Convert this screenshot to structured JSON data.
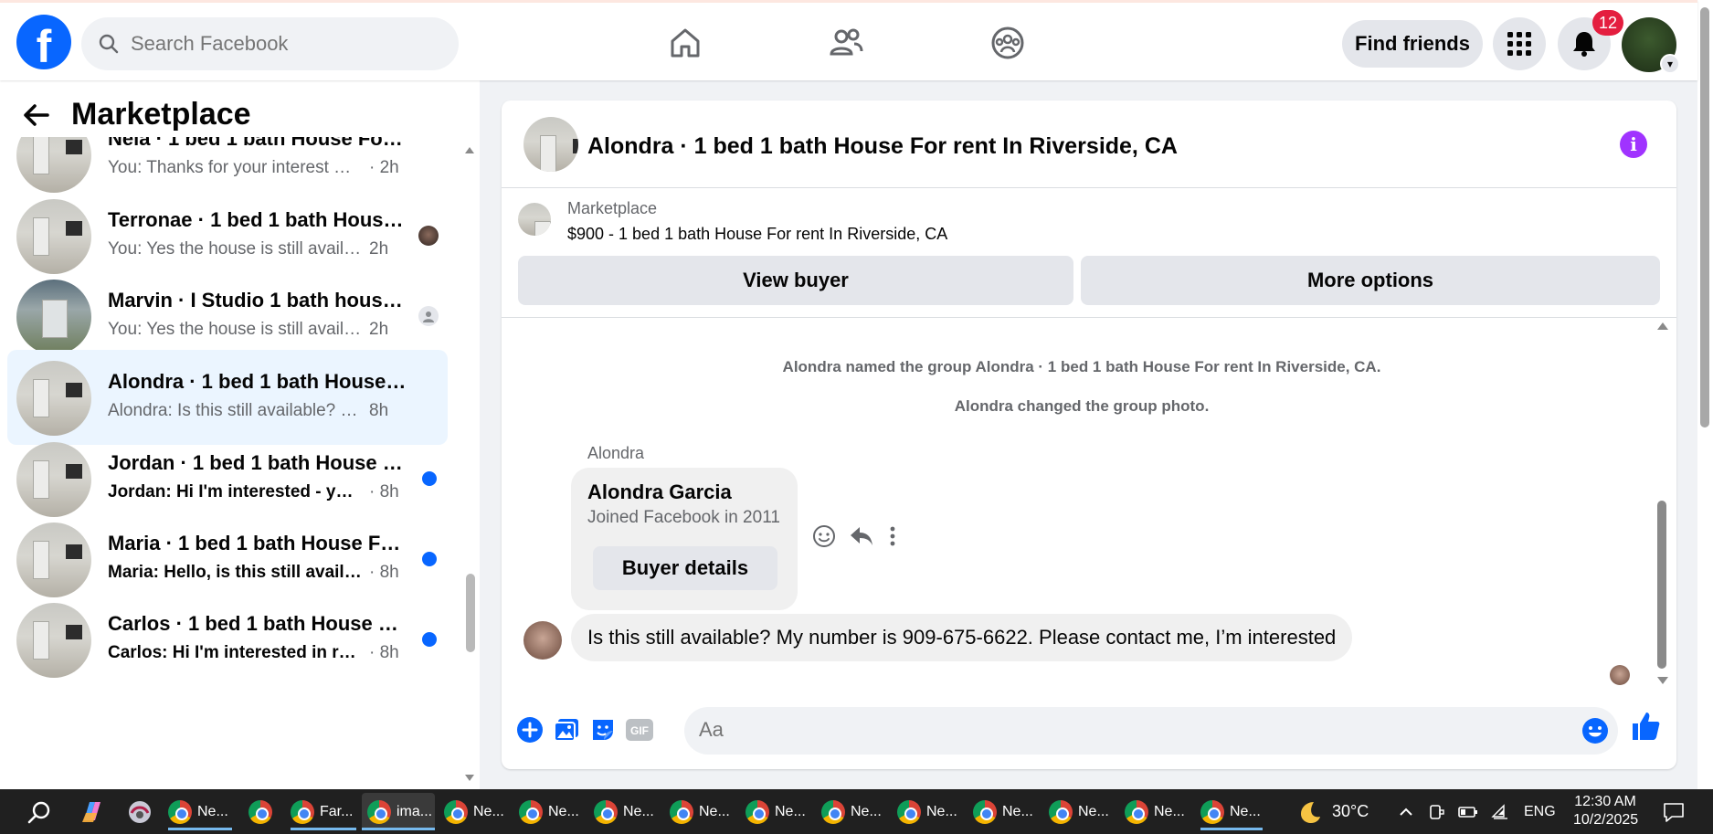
{
  "topbar": {
    "logo_letter": "f",
    "search_placeholder": "Search Facebook",
    "find_friends": "Find friends",
    "notification_count": "12"
  },
  "sidebar": {
    "title": "Marketplace",
    "conversations": [
      {
        "name": "Nela · 1 bed 1 bath House For re...",
        "preview": "You: Thanks for your interest Our t...",
        "time": "· 2h",
        "unread": false,
        "active": false
      },
      {
        "name": "Terronae · 1 bed 1 bath House ...",
        "preview": "You: Yes the house is still availabl...",
        "time": "2h",
        "unread": false,
        "active": false
      },
      {
        "name": "Marvin · I Studio 1 bath house...",
        "preview": "You: Yes the house is still availabl...",
        "time": "2h",
        "unread": false,
        "active": false
      },
      {
        "name": "Alondra · 1 bed 1 bath House Fo...",
        "preview": "Alondra: Is this still available? My n...",
        "time": "8h",
        "unread": false,
        "active": true
      },
      {
        "name": "Jordan · 1 bed 1 bath House Fo...",
        "preview": "Jordan: Hi I'm interested - you c...",
        "time": "· 8h",
        "unread": true,
        "active": false
      },
      {
        "name": "Maria · 1 bed 1 bath House For...",
        "preview": "Maria: Hello, is this still available?",
        "time": "· 8h",
        "unread": true,
        "active": false
      },
      {
        "name": "Carlos · 1 bed 1 bath House Fo...",
        "preview": "Carlos: Hi I'm interested in renti...",
        "time": "· 8h",
        "unread": true,
        "active": false
      }
    ]
  },
  "chat": {
    "title": "Alondra · 1 bed 1 bath House For rent In Riverside, CA",
    "listing_source": "Marketplace",
    "listing_title": "$900 - 1 bed 1 bath House For rent In Riverside, CA",
    "view_buyer": "View buyer",
    "more_options": "More options",
    "system_1": "Alondra named the group Alondra · 1 bed 1 bath House For rent In Riverside, CA.",
    "system_2": "Alondra changed the group photo.",
    "sender_label": "Alondra",
    "card_name": "Alondra Garcia",
    "card_sub": "Joined Facebook in 2011",
    "card_button": "Buyer details",
    "message": "Is this still available? My number is 909-675-6622. Please contact me, I’m interested",
    "composer_placeholder": "Aa"
  },
  "taskbar": {
    "items": [
      {
        "label": "Ne...",
        "badge": "G",
        "active": false
      },
      {
        "label": "",
        "badge": "U",
        "active": false
      },
      {
        "label": "Far...",
        "badge": "",
        "active": false
      },
      {
        "label": "ima...",
        "badge": "D",
        "active": true
      },
      {
        "label": "Ne...",
        "badge": "B",
        "active": false
      },
      {
        "label": "Ne...",
        "badge": "H",
        "active": false
      },
      {
        "label": "Ne...",
        "badge": "I",
        "active": false
      },
      {
        "label": "Ne...",
        "badge": "m",
        "active": false
      },
      {
        "label": "Ne...",
        "badge": "j",
        "active": false
      },
      {
        "label": "Ne...",
        "badge": "M",
        "active": false
      },
      {
        "label": "Ne...",
        "badge": "M",
        "active": false
      },
      {
        "label": "Ne...",
        "badge": "M",
        "active": false
      },
      {
        "label": "Ne...",
        "badge": "R",
        "active": false
      },
      {
        "label": "Ne...",
        "badge": "R",
        "active": false
      },
      {
        "label": "Ne...",
        "badge": "",
        "active": false
      }
    ],
    "weather": "30°C",
    "language": "ENG",
    "time": "12:30 AM",
    "date": "10/2/2025"
  },
  "colors": {
    "brand": "#0866ff",
    "active_conversation": "#ebf5ff",
    "badge": "#e41e3f",
    "info": "#a033ff"
  }
}
